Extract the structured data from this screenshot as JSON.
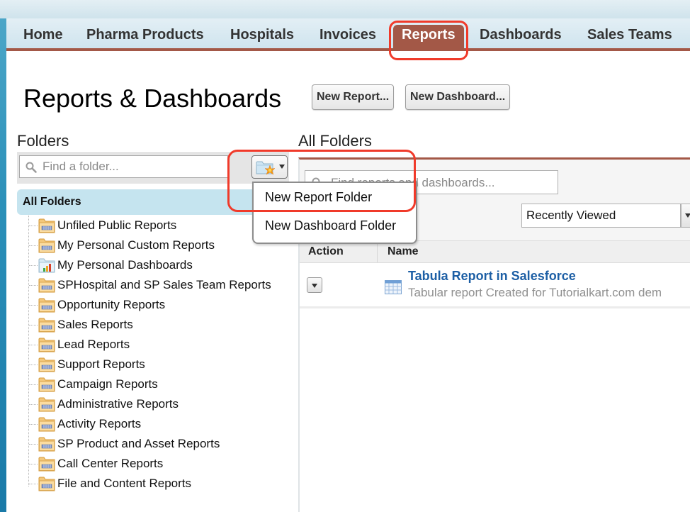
{
  "nav": {
    "tabs": [
      {
        "label": "Home",
        "active": false
      },
      {
        "label": "Pharma Products",
        "active": false
      },
      {
        "label": "Hospitals",
        "active": false
      },
      {
        "label": "Invoices",
        "active": false
      },
      {
        "label": "Reports",
        "active": true
      },
      {
        "label": "Dashboards",
        "active": false
      },
      {
        "label": "Sales Teams",
        "active": false
      }
    ]
  },
  "page": {
    "title": "Reports & Dashboards",
    "new_report_label": "New Report...",
    "new_dashboard_label": "New Dashboard..."
  },
  "folders_panel": {
    "heading": "Folders",
    "search_placeholder": "Find a folder...",
    "new_folder_button_icon": "folder-new-icon",
    "all_folders_label": "All Folders",
    "folders": [
      {
        "label": "Unfiled Public Reports",
        "icon": "report-folder-icon"
      },
      {
        "label": "My Personal Custom Reports",
        "icon": "report-folder-icon"
      },
      {
        "label": "My Personal Dashboards",
        "icon": "dashboard-folder-icon"
      },
      {
        "label": "SPHospital and SP Sales Team Reports",
        "icon": "report-folder-icon"
      },
      {
        "label": "Opportunity Reports",
        "icon": "report-folder-icon"
      },
      {
        "label": "Sales Reports",
        "icon": "report-folder-icon"
      },
      {
        "label": "Lead Reports",
        "icon": "report-folder-icon"
      },
      {
        "label": "Support Reports",
        "icon": "report-folder-icon"
      },
      {
        "label": "Campaign Reports",
        "icon": "report-folder-icon"
      },
      {
        "label": "Administrative Reports",
        "icon": "report-folder-icon"
      },
      {
        "label": "Activity Reports",
        "icon": "report-folder-icon"
      },
      {
        "label": "SP Product and Asset Reports",
        "icon": "report-folder-icon"
      },
      {
        "label": "Call Center Reports",
        "icon": "report-folder-icon"
      },
      {
        "label": "File and Content Reports",
        "icon": "report-folder-icon"
      }
    ]
  },
  "new_folder_menu": {
    "items": [
      "New Report Folder",
      "New Dashboard Folder"
    ]
  },
  "main_panel": {
    "heading": "All Folders",
    "search_placeholder": "Find reports and dashboards...",
    "view_selected": "Recently Viewed",
    "columns": [
      "Action",
      "Name"
    ],
    "rows": [
      {
        "name": "Tabula Report in Salesforce",
        "description": "Tabular report Created for Tutorialkart.com dem",
        "icon": "tabular-report-icon"
      }
    ]
  },
  "colors": {
    "accent": "#a35847",
    "annotation": "#f03a2a",
    "link": "#1d5fa5",
    "selected_folder_bg": "#c5e4ef"
  }
}
